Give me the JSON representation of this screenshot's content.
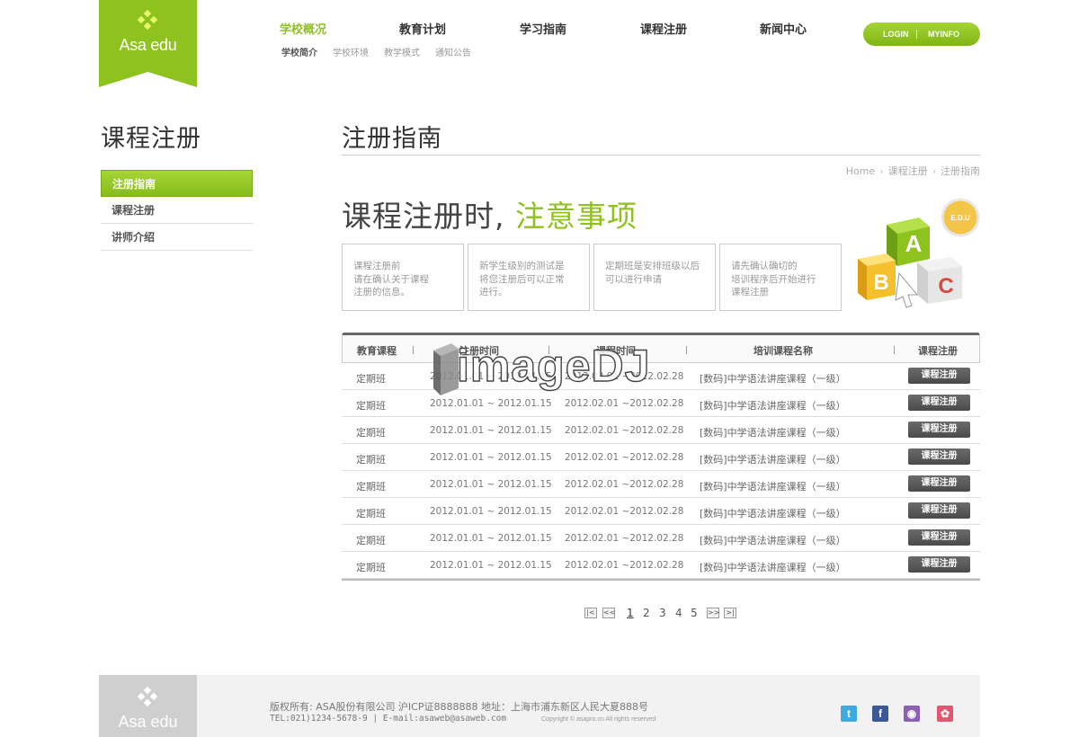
{
  "logo": {
    "text": "Asa edu"
  },
  "nav": {
    "items": [
      {
        "label": "学校概况"
      },
      {
        "label": "教育计划"
      },
      {
        "label": "学习指南"
      },
      {
        "label": "课程注册"
      },
      {
        "label": "新闻中心"
      }
    ],
    "sub_items": [
      {
        "label": "学校简介"
      },
      {
        "label": "学校环境"
      },
      {
        "label": "教学模式"
      },
      {
        "label": "通知公告"
      }
    ],
    "login_label": "LOGIN",
    "myinfo_label": "MYINFO"
  },
  "sidebar": {
    "title": "课程注册",
    "items": [
      {
        "label": "注册指南"
      },
      {
        "label": "课程注册"
      },
      {
        "label": "讲师介绍"
      }
    ]
  },
  "main": {
    "title": "注册指南",
    "breadcrumb": [
      "Home",
      "课程注册",
      "注册指南"
    ],
    "headline_dark": "课程注册时,",
    "headline_green": "注意事项",
    "badge": "E.D.U",
    "block_letters": [
      "A",
      "B",
      "C"
    ],
    "notes": [
      {
        "line1": "课程注册前",
        "line2": "请在确认关于课程",
        "line3": "注册的信息。"
      },
      {
        "line1": "新学生级别的测试是",
        "line2": "将您注册后可以正常",
        "line3": "进行。"
      },
      {
        "line1": "定期班是安排班级以后",
        "line2": "可以进行申请",
        "line3": ""
      },
      {
        "line1": "请先确认确切的",
        "line2": "培训程序后开始进行",
        "line3": "课程注册"
      }
    ]
  },
  "table": {
    "headers": [
      "教育课程",
      "注册时间",
      "课程时间",
      "培训课程名称",
      "课程注册"
    ],
    "rows": [
      {
        "course": "定期班",
        "reg_period": "2012.01.01 ~ 2012.01.15",
        "class_period": "2012.02.01 ~2012.02.28",
        "name": "[数码]中学语法讲座课程（一级）",
        "button": "课程注册"
      },
      {
        "course": "定期班",
        "reg_period": "2012.01.01 ~ 2012.01.15",
        "class_period": "2012.02.01 ~2012.02.28",
        "name": "[数码]中学语法讲座课程（一级）",
        "button": "课程注册"
      },
      {
        "course": "定期班",
        "reg_period": "2012.01.01 ~ 2012.01.15",
        "class_period": "2012.02.01 ~2012.02.28",
        "name": "[数码]中学语法讲座课程（一级）",
        "button": "课程注册"
      },
      {
        "course": "定期班",
        "reg_period": "2012.01.01 ~ 2012.01.15",
        "class_period": "2012.02.01 ~2012.02.28",
        "name": "[数码]中学语法讲座课程（一级）",
        "button": "课程注册"
      },
      {
        "course": "定期班",
        "reg_period": "2012.01.01 ~ 2012.01.15",
        "class_period": "2012.02.01 ~2012.02.28",
        "name": "[数码]中学语法讲座课程（一级）",
        "button": "课程注册"
      },
      {
        "course": "定期班",
        "reg_period": "2012.01.01 ~ 2012.01.15",
        "class_period": "2012.02.01 ~2012.02.28",
        "name": "[数码]中学语法讲座课程（一级）",
        "button": "课程注册"
      },
      {
        "course": "定期班",
        "reg_period": "2012.01.01 ~ 2012.01.15",
        "class_period": "2012.02.01 ~2012.02.28",
        "name": "[数码]中学语法讲座课程（一级）",
        "button": "课程注册"
      },
      {
        "course": "定期班",
        "reg_period": "2012.01.01 ~ 2012.01.15",
        "class_period": "2012.02.01 ~2012.02.28",
        "name": "[数码]中学语法讲座课程（一级）",
        "button": "课程注册"
      }
    ]
  },
  "pagination": {
    "pages": [
      "1",
      "2",
      "3",
      "4",
      "5"
    ],
    "current": "1"
  },
  "watermark": {
    "text": "imageDJ"
  },
  "footer": {
    "logo_text": "Asa edu",
    "line1": "版权所有: ASA股份有限公司 沪ICP证8888888 地址：上海市浦东新区人民大夏888号",
    "line2": "TEL:021)1234-5678-9 | E-mail:asaweb@asaweb.com",
    "copyright": "Copyright © asapro.cn All rights reserved",
    "social": [
      {
        "icon": "twitter-icon",
        "glyph": "t",
        "color": "#3fa9e0"
      },
      {
        "icon": "facebook-icon",
        "glyph": "f",
        "color": "#3b5998"
      },
      {
        "icon": "chat-icon",
        "glyph": "◉",
        "color": "#8a5fb5"
      },
      {
        "icon": "blog-icon",
        "glyph": "✿",
        "color": "#e0576f"
      }
    ]
  },
  "colors": {
    "brand_green": "#8dc21f",
    "dark_button": "#555555",
    "footer_bg": "#f2f2f2"
  }
}
